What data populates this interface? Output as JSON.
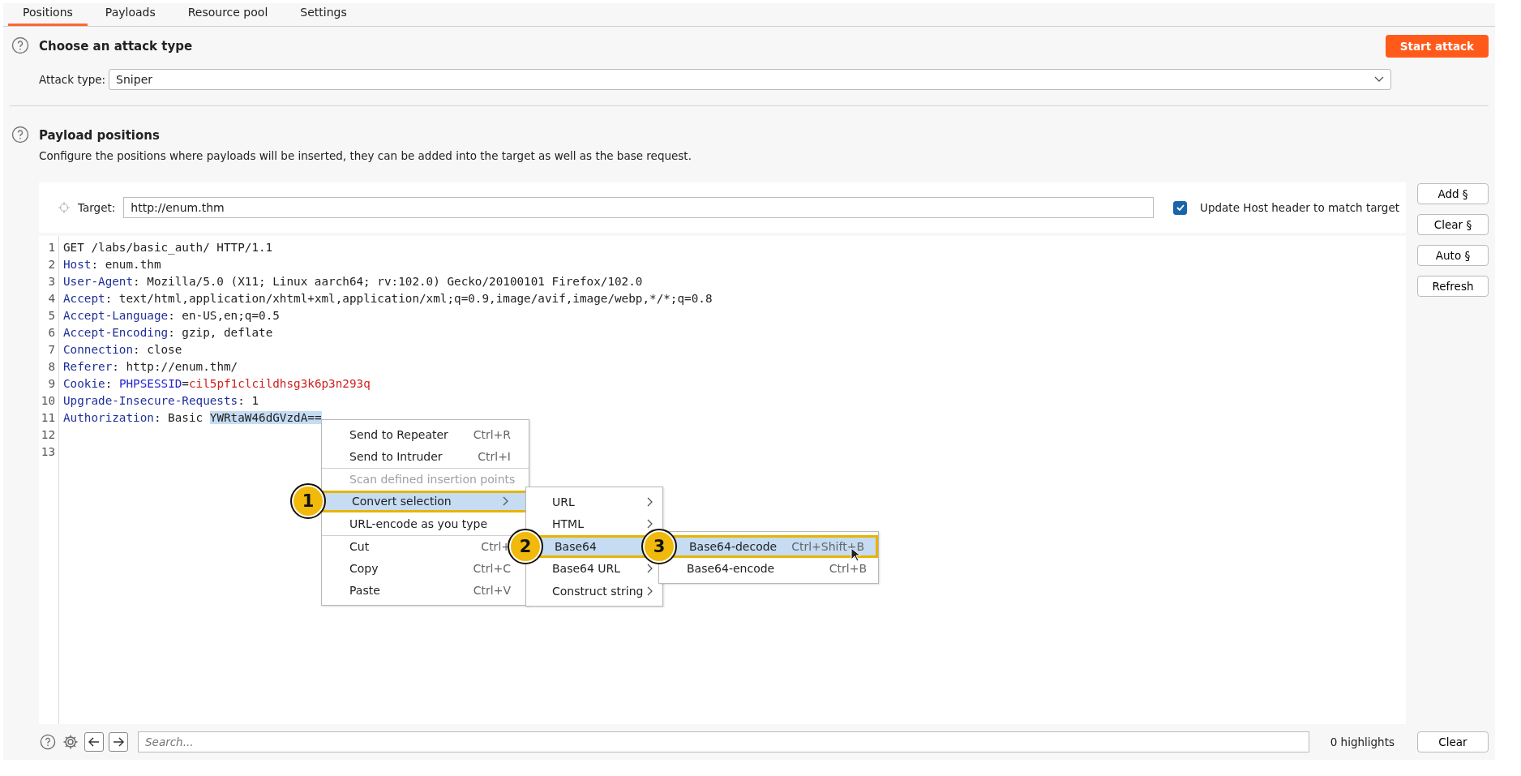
{
  "tabs": [
    {
      "label": "Positions",
      "selected": true
    },
    {
      "label": "Payloads",
      "selected": false
    },
    {
      "label": "Resource pool",
      "selected": false
    },
    {
      "label": "Settings",
      "selected": false
    }
  ],
  "attack_section": {
    "title": "Choose an attack type",
    "label": "Attack type:",
    "value": "Sniper",
    "start_button": "Start attack"
  },
  "payload_section": {
    "title": "Payload positions",
    "description": "Configure the positions where payloads will be inserted, they can be added into the target as well as the base request.",
    "target_label": "Target:",
    "target_value": "http://enum.thm",
    "update_host": {
      "label": "Update Host header to match target",
      "checked": true
    }
  },
  "side_buttons": [
    "Add §",
    "Clear §",
    "Auto §",
    "Refresh"
  ],
  "request_lines": [
    {
      "number": "1",
      "segments": [
        {
          "kind": "plain",
          "text": "GET /labs/basic_auth/ HTTP/1.1"
        }
      ]
    },
    {
      "number": "2",
      "segments": [
        {
          "kind": "header",
          "text": "Host"
        },
        {
          "kind": "plain",
          "text": ": enum.thm"
        }
      ]
    },
    {
      "number": "3",
      "segments": [
        {
          "kind": "header",
          "text": "User-Agent"
        },
        {
          "kind": "plain",
          "text": ": Mozilla/5.0 (X11; Linux aarch64; rv:102.0) Gecko/20100101 Firefox/102.0"
        }
      ]
    },
    {
      "number": "4",
      "segments": [
        {
          "kind": "header",
          "text": "Accept"
        },
        {
          "kind": "plain",
          "text": ": text/html,application/xhtml+xml,application/xml;q=0.9,image/avif,image/webp,*/*;q=0.8"
        }
      ]
    },
    {
      "number": "5",
      "segments": [
        {
          "kind": "header",
          "text": "Accept-Language"
        },
        {
          "kind": "plain",
          "text": ": en-US,en;q=0.5"
        }
      ]
    },
    {
      "number": "6",
      "segments": [
        {
          "kind": "header",
          "text": "Accept-Encoding"
        },
        {
          "kind": "plain",
          "text": ": gzip, deflate"
        }
      ]
    },
    {
      "number": "7",
      "segments": [
        {
          "kind": "header",
          "text": "Connection"
        },
        {
          "kind": "plain",
          "text": ": close"
        }
      ]
    },
    {
      "number": "8",
      "segments": [
        {
          "kind": "header",
          "text": "Referer"
        },
        {
          "kind": "plain",
          "text": ": http://enum.thm/"
        }
      ]
    },
    {
      "number": "9",
      "segments": [
        {
          "kind": "header",
          "text": "Cookie"
        },
        {
          "kind": "plain",
          "text": ": "
        },
        {
          "kind": "param",
          "text": "PHPSESSID"
        },
        {
          "kind": "plain",
          "text": "="
        },
        {
          "kind": "value",
          "text": "cil5pf1clcildhsg3k6p3n293q"
        }
      ]
    },
    {
      "number": "10",
      "segments": [
        {
          "kind": "header",
          "text": "Upgrade-Insecure-Requests"
        },
        {
          "kind": "plain",
          "text": ": 1"
        }
      ]
    },
    {
      "number": "11",
      "segments": [
        {
          "kind": "header",
          "text": "Authorization"
        },
        {
          "kind": "plain",
          "text": ": Basic "
        },
        {
          "kind": "selection",
          "text": "YWRtaW46dGVzdA=="
        }
      ]
    },
    {
      "number": "12"
    },
    {
      "number": "13"
    }
  ],
  "context_menu": {
    "items": [
      {
        "label": "Send to Repeater",
        "shortcut": "Ctrl+R",
        "disabled": false,
        "selected": false,
        "separator_before": false
      },
      {
        "label": "Send to Intruder",
        "shortcut": "Ctrl+I",
        "disabled": false,
        "selected": false,
        "separator_before": false
      },
      {
        "label": "Scan defined insertion points",
        "disabled": true,
        "selected": false,
        "separator_before": true
      },
      {
        "label": "Convert selection",
        "submenu": true,
        "disabled": false,
        "selected": true,
        "callout": "1",
        "separator_before": false
      },
      {
        "label": "URL-encode as you type",
        "disabled": false,
        "selected": false,
        "separator_before": false
      },
      {
        "label": "Cut",
        "shortcut": "Ctrl+",
        "disabled": false,
        "selected": false,
        "separator_before": true
      },
      {
        "label": "Copy",
        "shortcut": "Ctrl+C",
        "disabled": false,
        "selected": false,
        "separator_before": false
      },
      {
        "label": "Paste",
        "shortcut": "Ctrl+V",
        "disabled": false,
        "selected": false,
        "separator_before": false
      }
    ]
  },
  "convert_submenu": {
    "items": [
      {
        "label": "URL",
        "submenu": true,
        "selected": false
      },
      {
        "label": "HTML",
        "submenu": true,
        "selected": false
      },
      {
        "label": "Base64",
        "submenu": false,
        "selected": true,
        "callout": "2"
      },
      {
        "label": "Base64 URL",
        "submenu": true,
        "selected": false
      },
      {
        "label": "Construct string",
        "submenu": true,
        "selected": false
      }
    ]
  },
  "base64_submenu": {
    "items": [
      {
        "label": "Base64-decode",
        "shortcut": "Ctrl+Shift+B",
        "selected": true,
        "callout": "3"
      },
      {
        "label": "Base64-encode",
        "shortcut": "Ctrl+B",
        "selected": false
      }
    ]
  },
  "search": {
    "placeholder": "Search...",
    "highlights": "0 highlights",
    "clear_button": "Clear"
  }
}
